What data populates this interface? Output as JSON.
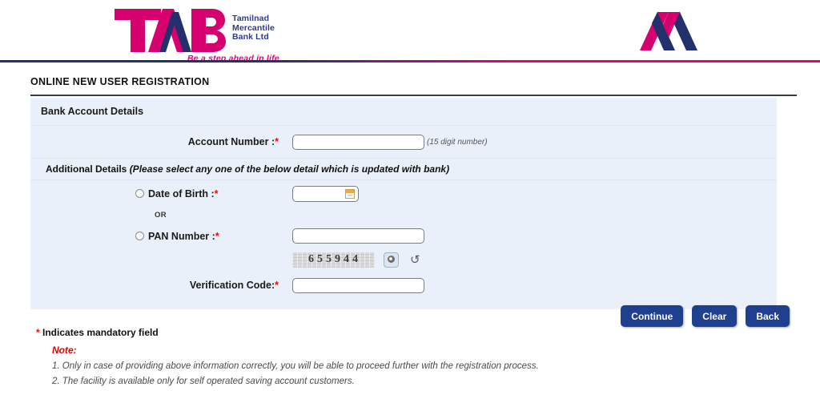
{
  "brand": {
    "logo_text": "TMB",
    "logo_name_lines": [
      "Tamilnad",
      "Mercantile",
      "Bank Ltd"
    ],
    "tagline": "Be a step ahead in life",
    "monogram": "M",
    "colors": {
      "magenta": "#d6006e",
      "navy": "#24306b",
      "accent_rule_left": "#24306b",
      "accent_rule_right": "#e5007e",
      "button": "#1f3f8f",
      "required_star": "#ff0000",
      "note": "#e00000",
      "panel_bg": "#eaf0fa"
    }
  },
  "page": {
    "title": "ONLINE NEW USER REGISTRATION"
  },
  "form": {
    "section_title": "Bank Account Details",
    "account_number": {
      "label": "Account Number :",
      "value": "",
      "placeholder": "",
      "hint": "(15 digit number)"
    },
    "additional_details": {
      "label": "Additional Details",
      "note": "(Please select any one of the below detail which is updated with bank)"
    },
    "date_of_birth": {
      "label": "Date of Birth :",
      "value": "",
      "placeholder": "",
      "icon": "calendar-icon"
    },
    "or_separator": "OR",
    "pan_number": {
      "label": "PAN Number :",
      "value": "",
      "placeholder": ""
    },
    "captcha": {
      "code": "655944",
      "digits": [
        "6",
        "5",
        "5",
        "9",
        "4",
        "4"
      ],
      "audio_icon": "audio-speaker-icon",
      "refresh_icon": "refresh-icon",
      "refresh_glyph": "↺"
    },
    "verification_code": {
      "label": "Verification Code:",
      "value": "",
      "placeholder": ""
    }
  },
  "buttons": {
    "continue": "Continue",
    "clear": "Clear",
    "back": "Back"
  },
  "footer": {
    "mandatory": "Indicates mandatory field",
    "note_title": "Note:",
    "notes": [
      {
        "num": "1.",
        "text": "Only in case of providing above information correctly, you will be able to proceed further with the registration process."
      },
      {
        "num": "2.",
        "text": "The facility is available only for self operated saving account customers."
      }
    ]
  }
}
